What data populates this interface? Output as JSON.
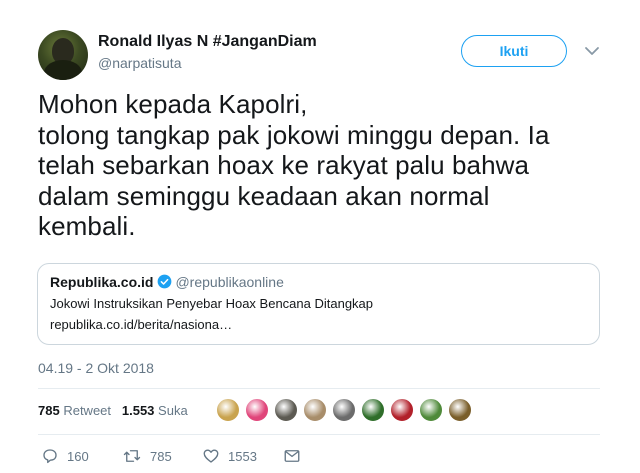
{
  "author": {
    "name": "Ronald Ilyas N #JanganDiam",
    "handle": "@narpatisuta"
  },
  "follow_label": "Ikuti",
  "tweet_lines": [
    "Mohon kepada Kapolri,",
    "tolong tangkap pak jokowi minggu depan. Ia",
    "telah sebarkan hoax ke rakyat palu bahwa",
    "dalam seminggu keadaan akan normal",
    "kembali."
  ],
  "card": {
    "source": "Republika.co.id",
    "handle": "@republikaonline",
    "title": "Jokowi Instruksikan Penyebar Hoax Bencana Ditangkap",
    "url": "republika.co.id/berita/nasiona…"
  },
  "timestamp": "04.19 - 2 Okt 2018",
  "stats": {
    "retweets": "785",
    "retweet_label": "Retweet",
    "likes": "1.553",
    "like_label": "Suka"
  },
  "likers": [
    {
      "icon": "liker-avatar-1",
      "color": "#c9a34e"
    },
    {
      "icon": "liker-avatar-2",
      "color": "#e0457a"
    },
    {
      "icon": "liker-avatar-3",
      "color": "#5c5a52"
    },
    {
      "icon": "liker-avatar-4",
      "color": "#a88d6a"
    },
    {
      "icon": "liker-avatar-5",
      "color": "#6b6b6b"
    },
    {
      "icon": "liker-avatar-6",
      "color": "#2f6e2a"
    },
    {
      "icon": "liker-avatar-7",
      "color": "#b2202a"
    },
    {
      "icon": "liker-avatar-8",
      "color": "#4f8a3a"
    },
    {
      "icon": "liker-avatar-9",
      "color": "#7a5e2a"
    }
  ],
  "actions": {
    "reply_count": "160",
    "retweet_count": "785",
    "like_count": "1553"
  },
  "colors": {
    "accent": "#1da1f2",
    "secondary_text": "#657786",
    "border": "#ccd6dd"
  }
}
